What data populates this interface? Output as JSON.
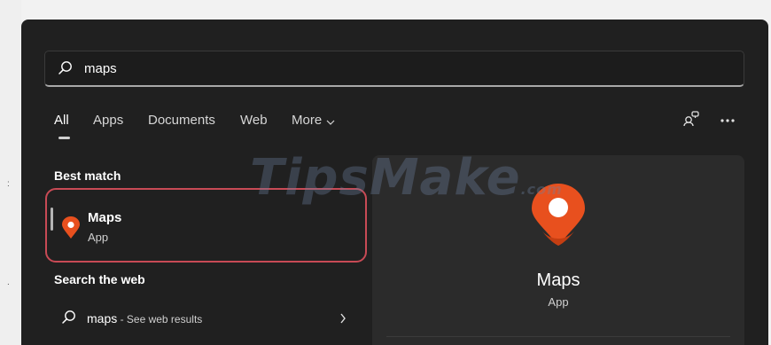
{
  "search": {
    "value": "maps"
  },
  "tabs": [
    {
      "label": "All",
      "active": true
    },
    {
      "label": "Apps"
    },
    {
      "label": "Documents"
    },
    {
      "label": "Web"
    },
    {
      "label": "More"
    }
  ],
  "sections": {
    "best_match": "Best match",
    "search_web": "Search the web"
  },
  "best_match_result": {
    "name": "Maps",
    "type": "App"
  },
  "web_result": {
    "query": "maps",
    "suffix": " - See web results"
  },
  "preview": {
    "name": "Maps",
    "type": "App"
  },
  "watermark": {
    "text": "TipsMake",
    "suffix": ".com"
  },
  "icons": {
    "search": "search-icon",
    "more_chevron": "chevron-down-icon",
    "account_switch": "account-switch-icon",
    "overflow": "more-options-icon",
    "maps_app": "map-pin-icon",
    "web_search": "search-icon",
    "open_arrow": "chevron-right-icon"
  },
  "colors": {
    "panel_bg": "#202020",
    "preview_bg": "#2b2b2b",
    "maps_orange": "#e8501e",
    "highlight_border": "#c84a55"
  }
}
